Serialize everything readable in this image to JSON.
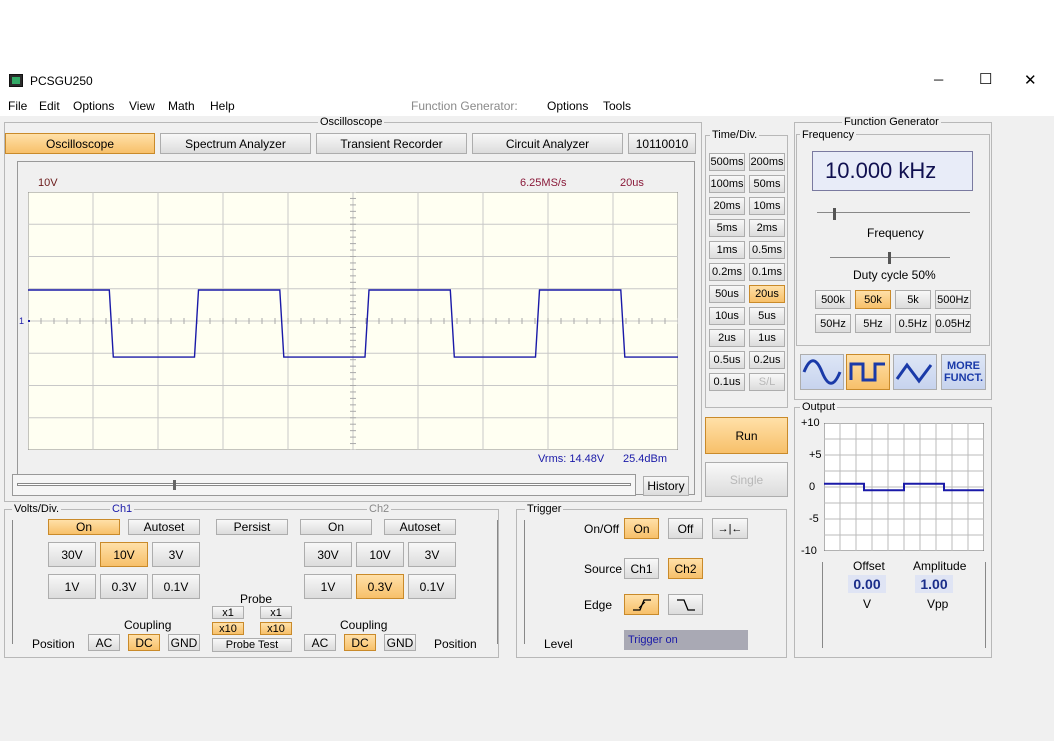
{
  "window": {
    "title": "PCSGU250",
    "minimize": "─",
    "maximize": "☐",
    "close": "✕"
  },
  "menu": [
    "File",
    "Edit",
    "Options",
    "View",
    "Math",
    "Help"
  ],
  "fg_menu": {
    "label": "Function Generator:",
    "items": [
      "Options",
      "Tools"
    ]
  },
  "osc": {
    "group": "Oscilloscope",
    "tabs": [
      "Oscilloscope",
      "Spectrum Analyzer",
      "Transient Recorder",
      "Circuit Analyzer",
      "10110010"
    ],
    "screen": {
      "volts": "10V",
      "rate": "6.25MS/s",
      "time": "20us",
      "marker": "1",
      "vrms": "Vrms: 14.48V",
      "dbm": "25.4dBm"
    },
    "history": "History",
    "waveform": {
      "divisions_x": 10,
      "divisions_y": 8,
      "period_div": 2.5,
      "high_div": 0.48,
      "low_div": -0.56,
      "ch1_volts_per_div": 10,
      "start_phase_div": 0
    }
  },
  "timediv": {
    "label": "Time/Div.",
    "buttons": [
      [
        "500ms",
        "200ms"
      ],
      [
        "100ms",
        "50ms"
      ],
      [
        "20ms",
        "10ms"
      ],
      [
        "5ms",
        "2ms"
      ],
      [
        "1ms",
        "0.5ms"
      ],
      [
        "0.2ms",
        "0.1ms"
      ],
      [
        "50us",
        "20us"
      ],
      [
        "10us",
        "5us"
      ],
      [
        "2us",
        "1us"
      ],
      [
        "0.5us",
        "0.2us"
      ],
      [
        "0.1us",
        "S/L"
      ]
    ],
    "selected": "20us"
  },
  "run": "Run",
  "single": "Single",
  "volts": {
    "label": "Volts/Div.",
    "ch1": "Ch1",
    "ch2": "Ch2",
    "on": "On",
    "autoset": "Autoset",
    "persist": "Persist",
    "row1": [
      "30V",
      "10V",
      "3V"
    ],
    "row2": [
      "1V",
      "0.3V",
      "0.1V"
    ],
    "ch1_selected": "10V",
    "ch2_selected": "0.3V",
    "probe": "Probe",
    "x1": "x1",
    "x10": "x10",
    "coupling": "Coupling",
    "ac": "AC",
    "dc": "DC",
    "gnd": "GND",
    "probe_test": "Probe Test",
    "position": "Position"
  },
  "trigger": {
    "label": "Trigger",
    "onoff": "On/Off",
    "on": "On",
    "off": "Off",
    "source": "Source",
    "ch1": "Ch1",
    "ch2": "Ch2",
    "edge": "Edge",
    "level": "Level",
    "status": "Trigger on",
    "expand": "→|←"
  },
  "fg": {
    "group": "Function Generator",
    "freq_label": "Frequency",
    "freq_value": "10.000 kHz",
    "freq_slider": "Frequency",
    "duty": "Duty cycle 50%",
    "ranges_row1": [
      "500k",
      "50k",
      "5k",
      "500Hz"
    ],
    "ranges_row2": [
      "50Hz",
      "5Hz",
      "0.5Hz",
      "0.05Hz"
    ],
    "range_selected": "50k",
    "more": "MORE FUNCT.",
    "selected_wave": "square",
    "output": "Output",
    "yticks": [
      "+10",
      "+5",
      "0",
      "-5",
      "-10"
    ],
    "offset_label": "Offset",
    "offset": "0.00",
    "offset_unit": "V",
    "amp_label": "Amplitude",
    "amp": "1.00",
    "amp_unit": "Vpp"
  },
  "colors": {
    "trace": "#1a1aa8",
    "highlight": "#f7c06a",
    "screen": "#fffff2",
    "grid": "#c8c8c8"
  }
}
